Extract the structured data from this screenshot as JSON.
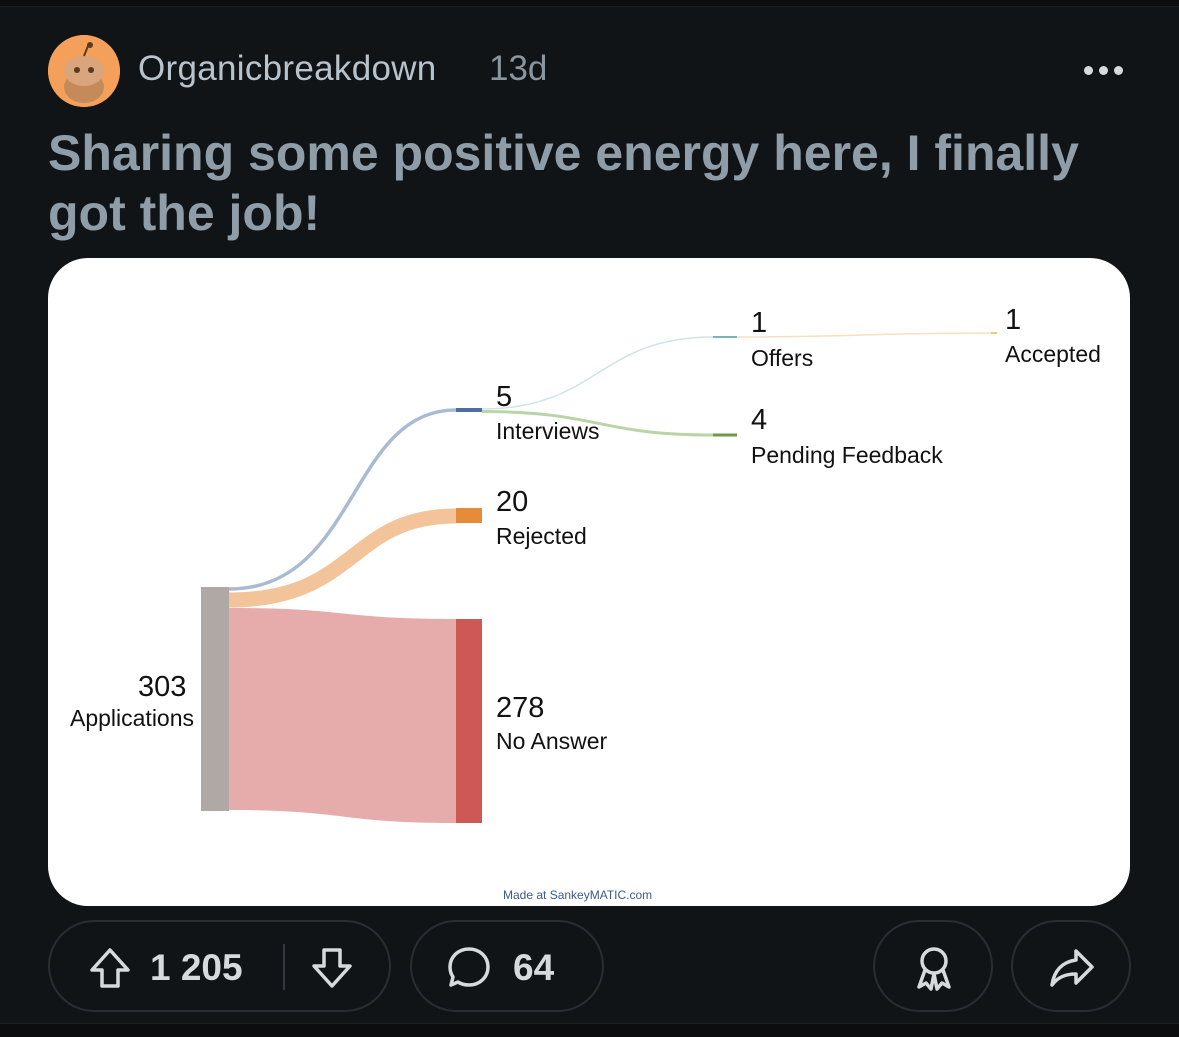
{
  "post": {
    "username": "Organicbreakdown",
    "age": "13d",
    "title": "Sharing some positive energy here, I finally got the job!"
  },
  "chart_data": {
    "type": "sankey",
    "nodes": [
      {
        "id": "applications",
        "name": "Applications",
        "value": 303,
        "color": "#b0a8a4"
      },
      {
        "id": "interviews",
        "name": "Interviews",
        "value": 5,
        "color": "#4d6fa0"
      },
      {
        "id": "rejected",
        "name": "Rejected",
        "value": 20,
        "color": "#e68a3c"
      },
      {
        "id": "noanswer",
        "name": "No Answer",
        "value": 278,
        "color": "#cd5855"
      },
      {
        "id": "offers",
        "name": "Offers",
        "value": 1,
        "color": "#7ab3c0"
      },
      {
        "id": "pending",
        "name": "Pending Feedback",
        "value": 4,
        "color": "#6f9a4a"
      },
      {
        "id": "accepted",
        "name": "Accepted",
        "value": 1,
        "color": "#f0c878"
      }
    ],
    "links": [
      {
        "source": "applications",
        "target": "interviews",
        "value": 5
      },
      {
        "source": "applications",
        "target": "rejected",
        "value": 20
      },
      {
        "source": "applications",
        "target": "noanswer",
        "value": 278
      },
      {
        "source": "interviews",
        "target": "offers",
        "value": 1
      },
      {
        "source": "interviews",
        "target": "pending",
        "value": 4
      },
      {
        "source": "offers",
        "target": "accepted",
        "value": 1
      }
    ],
    "credit": "Made at SankeyMATIC.com"
  },
  "actions": {
    "upvotes": "1 205",
    "comments": "64"
  },
  "icons": {
    "upvote": "arrow-up-icon",
    "downvote": "arrow-down-icon",
    "comment": "speech-bubble-icon",
    "award": "award-ribbon-icon",
    "share": "share-arrow-icon",
    "more": "three-dots-icon"
  }
}
